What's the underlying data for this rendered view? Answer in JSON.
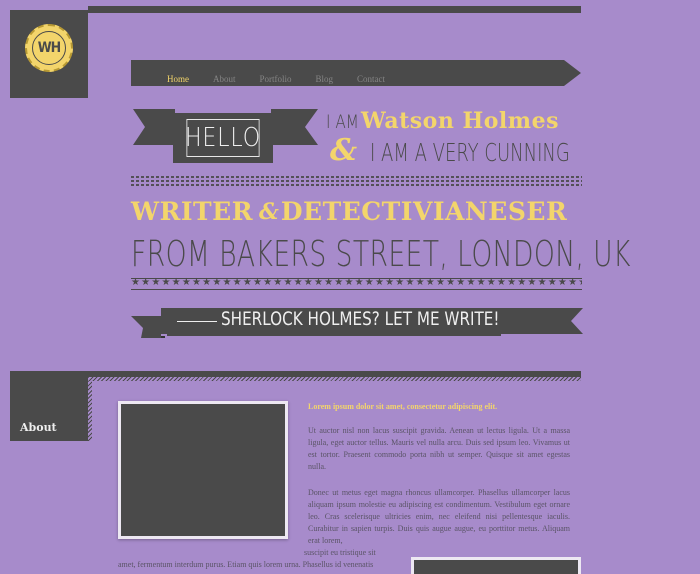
{
  "logo": {
    "initials": "WH"
  },
  "nav": {
    "items": [
      {
        "label": "Home",
        "active": true
      },
      {
        "label": "About",
        "active": false
      },
      {
        "label": "Portfolio",
        "active": false
      },
      {
        "label": "Blog",
        "active": false
      },
      {
        "label": "Contact",
        "active": false
      }
    ]
  },
  "hero": {
    "hello": "HELLO",
    "i_am": "I AM",
    "name": "Watson Holmes",
    "ampersand": "&",
    "cunning": "I AM A VERY CUNNING",
    "writer": "WRITER",
    "writer_amp": "&",
    "detective": "DETECTIVIANESER",
    "from": "FROM BAKERS STREET, LONDON, UK",
    "stars": "★★★★★★★★★★★★★★★★★★★★★★★★★★★★★★★★★★★★★★★★★★★★★★★★★★★★★★★★★★★★",
    "sherlock": "SHERLOCK HOLMES? LET ME WRITE!"
  },
  "about": {
    "heading": "About",
    "lede": "Lorem ipsum dolor sit amet, consectetur adipiscing elit.",
    "para1": "Ut auctor nisl non lacus suscipit gravida. Aenean ut lectus ligula. Ut a massa ligula, eget auctor tellus. Mauris vel nulla arcu. Duis sed ipsum leo. Vivamus ut est tortor. Praesent commodo porta nibh ut semper. Quisque sit amet egestas nulla.",
    "para2": "Donec ut metus eget magna rhoncus ullamcorper. Phasellus ullamcorper lacus aliquam ipsum molestie eu adipiscing est condimentum. Vestibulum eget ornare leo. Cras scelerisque ultricies enim, nec eleifend nisi pellentesque iaculis. Curabitur in sapien turpis. Duis quis augue augue, eu porttitor metus. Aliquam erat lorem,",
    "wrap1": "suscipit eu tristique sit",
    "wrap2": "amet, fermentum interdum purus. Etiam quis lorem urna. Phasellus id venenatis"
  },
  "colors": {
    "background": "#a78bcb",
    "dark": "#4a4a4a",
    "accent": "#f3d56b",
    "light": "#efefef"
  }
}
